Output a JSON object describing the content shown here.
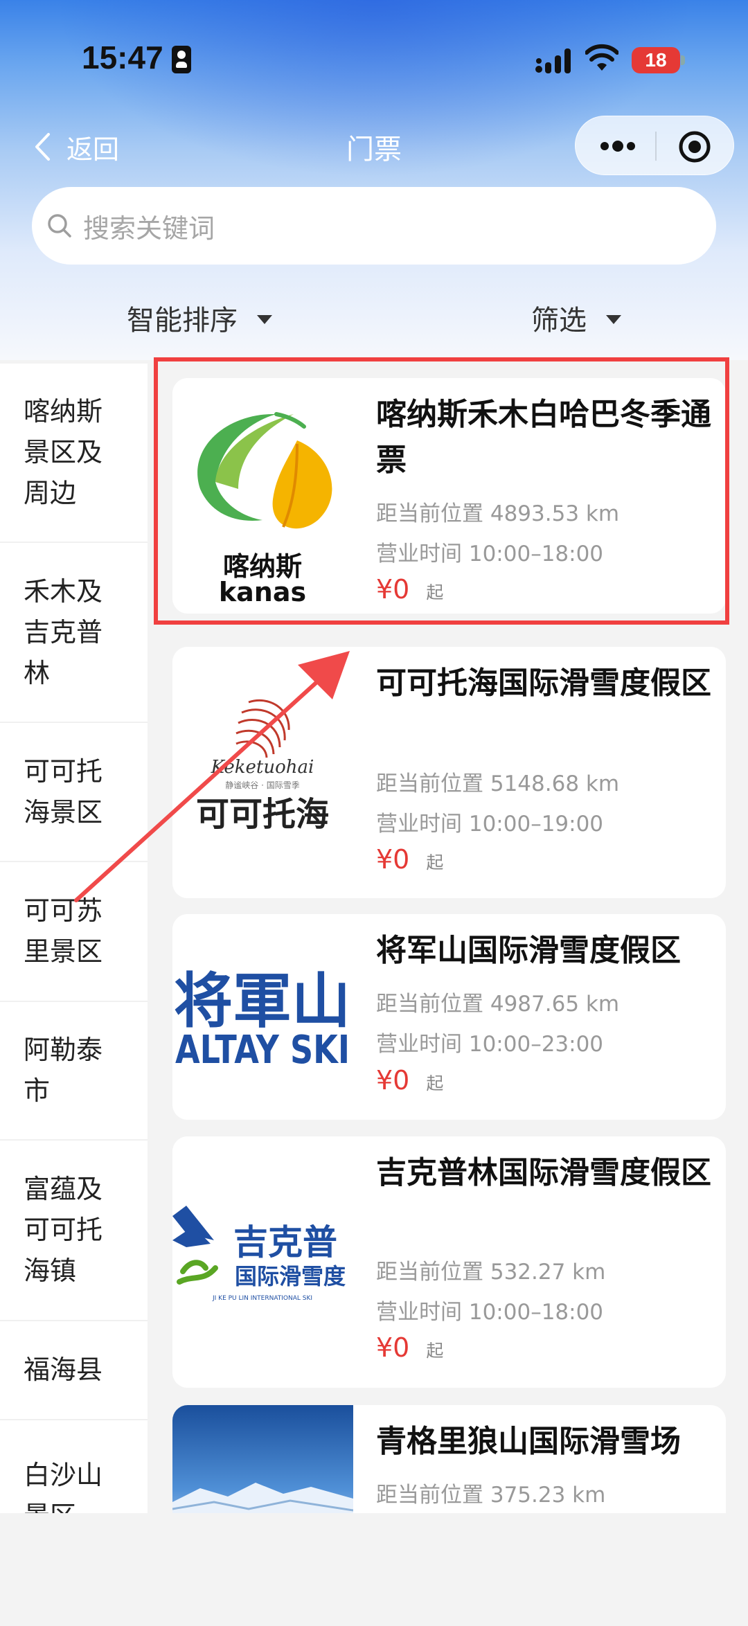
{
  "status_bar": {
    "time": "15:47",
    "battery": "18"
  },
  "nav": {
    "back_label": "返回",
    "title": "门票"
  },
  "search": {
    "placeholder": "搜索关键词"
  },
  "filters": {
    "sort_label": "智能排序",
    "filter_label": "筛选"
  },
  "sidebar": {
    "items": [
      {
        "label": "喀纳斯景区及周边"
      },
      {
        "label": "禾木及吉克普林"
      },
      {
        "label": "可可托海景区"
      },
      {
        "label": "可可苏里景区"
      },
      {
        "label": "阿勒泰市"
      },
      {
        "label": "富蕴及可可托海镇"
      },
      {
        "label": "福海县"
      },
      {
        "label": "白沙山景区"
      }
    ]
  },
  "tickets": [
    {
      "name": "喀纳斯禾木白哈巴冬季通票",
      "distance": "距当前位置 4893.53 km",
      "hours": "营业时间 10:00–18:00",
      "price": "¥0",
      "price_suffix": "起",
      "logo_text_cn": "喀纳斯",
      "logo_text_en": "kanas"
    },
    {
      "name": "可可托海国际滑雪度假区",
      "distance": "距当前位置 5148.68 km",
      "hours": "营业时间 10:00–19:00",
      "price": "¥0",
      "price_suffix": "起",
      "logo_text_cn": "可可托海",
      "logo_text_en": "Keketuohai",
      "logo_tagline": "静谧峡谷 · 国际雪季"
    },
    {
      "name": "将军山国际滑雪度假区",
      "distance": "距当前位置 4987.65 km",
      "hours": "营业时间 10:00–23:00",
      "price": "¥0",
      "price_suffix": "起",
      "logo_text_cn": "将軍山",
      "logo_text_en": "ALTAY SKI"
    },
    {
      "name": "吉克普林国际滑雪度假区",
      "distance": "距当前位置 532.27 km",
      "hours": "营业时间 10:00–18:00",
      "price": "¥0",
      "price_suffix": "起",
      "logo_text_cn": "吉克普",
      "logo_subtext": "国际滑雪度",
      "logo_text_en": "JI KE PU LIN INTERNATIONAL SKI"
    },
    {
      "name": "青格里狼山国际滑雪场",
      "distance": "距当前位置 375.23 km"
    }
  ],
  "colors": {
    "price_red": "#e53935",
    "highlight_red": "#f04040",
    "hero_blue": "#3a82e8"
  }
}
